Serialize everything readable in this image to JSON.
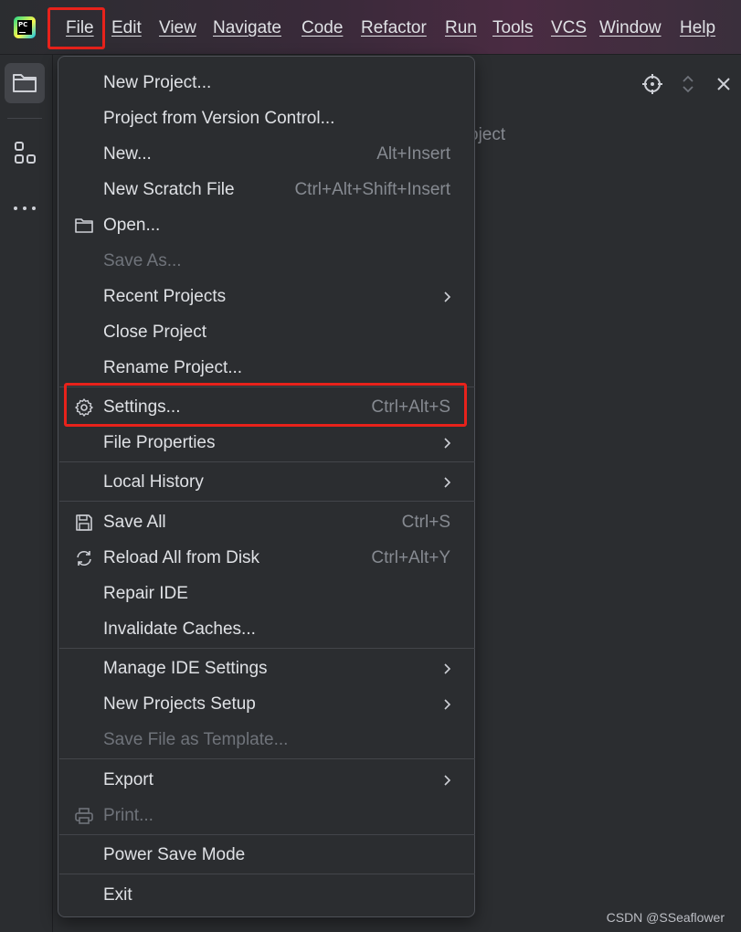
{
  "colors": {
    "background": "#2b2d30",
    "text": "#dfe1e5",
    "muted": "#868a91",
    "disabled": "#6f737a",
    "highlight_outline": "#e8221b"
  },
  "app": {
    "logo_icon": "pycharm-logo",
    "logo_text": "PC"
  },
  "menubar": {
    "file": "File",
    "edit": "Edit",
    "view": "View",
    "navigate": "Navigate",
    "code": "Code",
    "refactor": "Refactor",
    "run": "Run",
    "tools": "Tools",
    "vcs": "VCS",
    "window": "Window",
    "help": "Help"
  },
  "toolstrip": {
    "icons": [
      "folder-icon",
      "structure-icon",
      "more-icon"
    ]
  },
  "editor": {
    "hint_text": "oject",
    "header_icons": [
      "locate-icon",
      "expand-collapse-icon",
      "close-icon"
    ],
    "watermark": "CSDN @SSeaflower"
  },
  "file_menu": {
    "new_project": "New Project...",
    "project_from_vcs": "Project from Version Control...",
    "new": "New...",
    "new_shortcut": "Alt+Insert",
    "new_scratch_file": "New Scratch File",
    "new_scratch_file_shortcut": "Ctrl+Alt+Shift+Insert",
    "open": "Open...",
    "save_as": "Save As...",
    "recent_projects": "Recent Projects",
    "close_project": "Close Project",
    "rename_project": "Rename Project...",
    "settings": "Settings...",
    "settings_shortcut": "Ctrl+Alt+S",
    "file_properties": "File Properties",
    "local_history": "Local History",
    "save_all": "Save All",
    "save_all_shortcut": "Ctrl+S",
    "reload_all": "Reload All from Disk",
    "reload_all_shortcut": "Ctrl+Alt+Y",
    "repair_ide": "Repair IDE",
    "invalidate_caches": "Invalidate Caches...",
    "manage_ide_settings": "Manage IDE Settings",
    "new_projects_setup": "New Projects Setup",
    "save_file_as_template": "Save File as Template...",
    "export": "Export",
    "print": "Print...",
    "power_save_mode": "Power Save Mode",
    "exit": "Exit"
  }
}
